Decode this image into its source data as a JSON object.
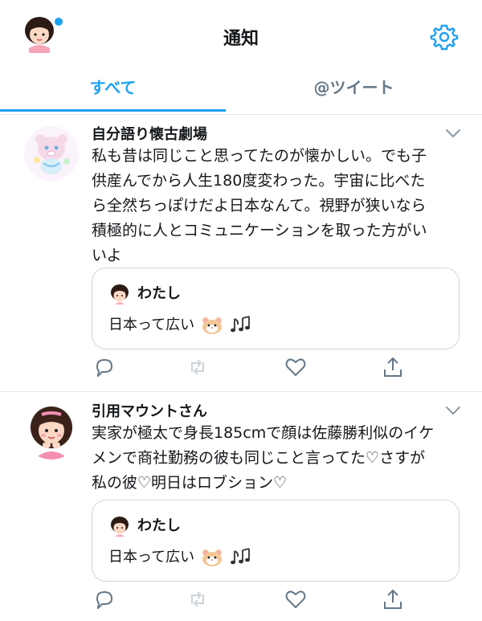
{
  "header": {
    "title": "通知"
  },
  "tabs": [
    {
      "label": "すべて"
    },
    {
      "label": "@ツイート"
    }
  ],
  "tweets": [
    {
      "name": "自分語り懐古劇場",
      "lines": [
        "私も昔は同じこと思ってたのが懐かしい。でも子",
        "供産んでから人生180度変わった。宇宙に比べた",
        "ら全然ちっぽけだよ日本なんて。視野が狭いなら",
        "積極的に人とコミュニケーションを取った方がい",
        "いよ"
      ],
      "quote": {
        "name": "わたし",
        "text": "日本って広い"
      }
    },
    {
      "name": "引用マウントさん",
      "lines": [
        "実家が極太で身長185cmで顔は佐藤勝利似のイケ",
        "メンで商社勤務の彼も同じこと言ってた♡さすが",
        "私の彼♡明日はロブション♡"
      ],
      "quote": {
        "name": "わたし",
        "text": "日本って広い"
      }
    }
  ],
  "colors": {
    "accent": "#1da1f2",
    "muted": "#657786",
    "border": "#e1e8ed"
  },
  "icons": [
    "avatar-me",
    "gear-icon",
    "chevron-down-icon",
    "reply-icon",
    "retweet-icon",
    "like-icon",
    "share-icon",
    "hamster-icon",
    "music-notes-icon"
  ]
}
